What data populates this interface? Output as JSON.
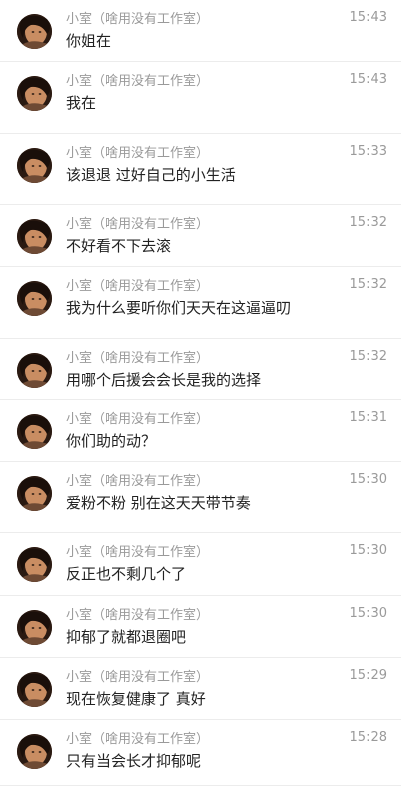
{
  "messages": [
    {
      "sender": "小室（啥用没有工作室）",
      "time": "15:43",
      "text": "你姐在",
      "avatar": "user-avatar"
    },
    {
      "sender": "小室（啥用没有工作室）",
      "time": "15:43",
      "text": "我在",
      "avatar": "user-avatar"
    },
    {
      "sender": "小室（啥用没有工作室）",
      "time": "15:33",
      "text": "该退退 过好自己的小生活",
      "avatar": "user-avatar"
    },
    {
      "sender": "小室（啥用没有工作室）",
      "time": "15:32",
      "text": "不好看不下去滚",
      "avatar": "user-avatar"
    },
    {
      "sender": "小室（啥用没有工作室）",
      "time": "15:32",
      "text": "我为什么要听你们天天在这逼逼叨",
      "avatar": "user-avatar"
    },
    {
      "sender": "小室（啥用没有工作室）",
      "time": "15:32",
      "text": "用哪个后援会会长是我的选择",
      "avatar": "user-avatar"
    },
    {
      "sender": "小室（啥用没有工作室）",
      "time": "15:31",
      "text": "你们助的动？",
      "avatar": "user-avatar"
    },
    {
      "sender": "小室（啥用没有工作室）",
      "time": "15:30",
      "text": "爱粉不粉 别在这天天带节奏",
      "avatar": "user-avatar"
    },
    {
      "sender": "小室（啥用没有工作室）",
      "time": "15:30",
      "text": "反正也不剩几个了",
      "avatar": "user-avatar"
    },
    {
      "sender": "小室（啥用没有工作室）",
      "time": "15:30",
      "text": "抑郁了就都退圈吧",
      "avatar": "user-avatar"
    },
    {
      "sender": "小室（啥用没有工作室）",
      "time": "15:29",
      "text": "现在恢复健康了 真好",
      "avatar": "user-avatar"
    },
    {
      "sender": "小室（啥用没有工作室）",
      "time": "15:28",
      "text": "只有当会长才抑郁呢",
      "avatar": "user-avatar"
    }
  ]
}
